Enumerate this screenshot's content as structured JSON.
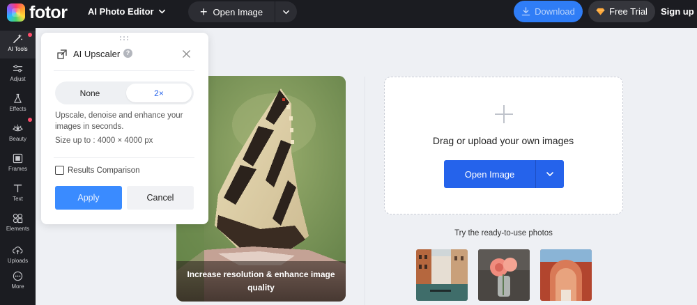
{
  "topbar": {
    "logo_text": "fotor",
    "app_menu_label": "AI Photo Editor",
    "open_image_label": "Open Image",
    "download_label": "Download",
    "free_trial_label": "Free Trial",
    "signup_label": "Sign up"
  },
  "sidebar": {
    "items": [
      {
        "label": "AI Tools",
        "icon": "sparkle-wand-icon",
        "active": true,
        "dot": true
      },
      {
        "label": "Adjust",
        "icon": "sliders-icon",
        "active": false,
        "dot": false
      },
      {
        "label": "Effects",
        "icon": "flask-icon",
        "active": false,
        "dot": false
      },
      {
        "label": "Beauty",
        "icon": "eye-icon",
        "active": false,
        "dot": true
      },
      {
        "label": "Frames",
        "icon": "frame-icon",
        "active": false,
        "dot": false
      },
      {
        "label": "Text",
        "icon": "text-icon",
        "active": false,
        "dot": false
      },
      {
        "label": "Elements",
        "icon": "shapes-icon",
        "active": false,
        "dot": false
      },
      {
        "label": "Uploads",
        "icon": "cloud-upload-icon",
        "active": false,
        "dot": false
      },
      {
        "label": "More",
        "icon": "more-icon",
        "active": false,
        "dot": false
      }
    ]
  },
  "panel": {
    "title": "AI Upscaler",
    "help": "?",
    "options": [
      "None",
      "2×"
    ],
    "selected_option": "2×",
    "description": "Upscale, denoise and enhance your images in seconds.",
    "size_text": "Size up to : 4000 × 4000 px",
    "comparison_label": "Results Comparison",
    "comparison_checked": false,
    "apply_label": "Apply",
    "cancel_label": "Cancel"
  },
  "preview": {
    "caption": "Increase resolution & enhance image quality"
  },
  "upload": {
    "title": "Drag or upload your own images",
    "button_label": "Open Image",
    "try_label": "Try the ready-to-use photos",
    "samples": [
      "venice-canal-photo",
      "pink-rose-vase-photo",
      "red-arch-street-photo"
    ]
  },
  "colors": {
    "topbar_bg": "#1b1c21",
    "accent_blue": "#2563eb",
    "download_blue": "#2f7df6",
    "notification_red": "#ff4d6a"
  }
}
